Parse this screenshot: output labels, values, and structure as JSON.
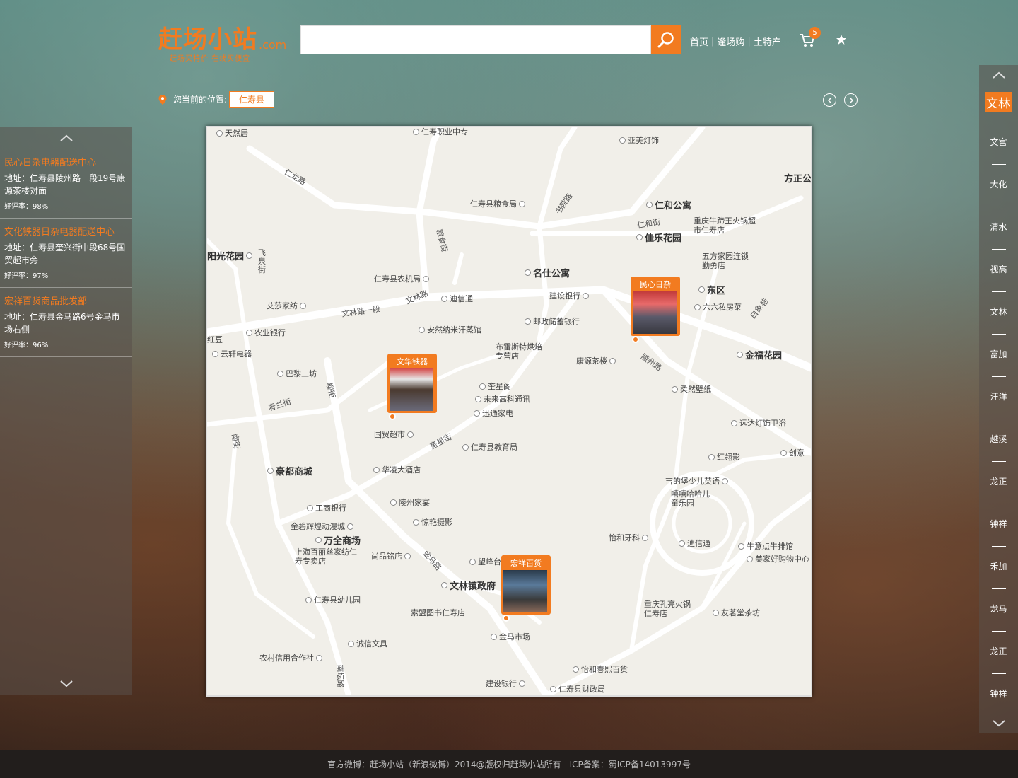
{
  "brand": {
    "logo_text": "赶场小站",
    "logo_domain": ".com",
    "slogan": "赶场买特价  在线买便宜"
  },
  "search": {
    "value": "",
    "placeholder": ""
  },
  "topnav": {
    "items": [
      "首页",
      "逢场购",
      "土特产"
    ],
    "cart_count": "5"
  },
  "location": {
    "label": "您当前的位置:",
    "current": "仁寿县"
  },
  "left_panel": {
    "shops": [
      {
        "name": "民心日杂电器配送中心",
        "address": "地址：仁寿县陵州路一段19号康源茶楼对面",
        "rating": "好评率：98%"
      },
      {
        "name": "文化铁器日杂电器配送中心",
        "address": "地址：仁寿县奎兴街中段68号国贸超市旁",
        "rating": "好评率：97%"
      },
      {
        "name": "宏祥百货商品批发部",
        "address": "地址：仁寿县金马路6号金马市场右侧",
        "rating": "好评率：96%"
      }
    ]
  },
  "map": {
    "markers": [
      {
        "title": "民心日杂"
      },
      {
        "title": "文华铁器"
      },
      {
        "title": "宏祥百货"
      }
    ],
    "roads": [
      "仁龙路",
      "书院路",
      "仁和街",
      "粮食街",
      "文林路一段",
      "文林路",
      "陵州路",
      "白象巷",
      "柳街",
      "春兰街",
      "奎星街",
      "南街",
      "金马路",
      "南坛路"
    ],
    "pois": [
      "天然居",
      "仁寿职业中专",
      "亚美灯饰",
      "方正公",
      "仁寿县粮食局",
      "仁和公寓",
      "重庆牛蹄王火锅超市仁寿店",
      "佳乐花园",
      "阳光花园",
      "飞泉街",
      "五方家园连锁勤勇店",
      "名仕公寓",
      "仁寿县农机局",
      "东区",
      "建设银行",
      "艾莎家纺",
      "迪信通",
      "六六私房菜",
      "邮政储蓄银行",
      "农业银行",
      "安然纳米汗蒸馆",
      "金福花园",
      "红豆",
      "云轩电器",
      "布雷斯特烘焙专营店",
      "康源茶楼",
      "巴黎工坊",
      "柔然壁纸",
      "奎星阁",
      "未来高科通讯",
      "远达灯饰卫浴",
      "迅通家电",
      "国贸超市",
      "仁寿县教育局",
      "红翎影",
      "创意",
      "豪都商城",
      "华凌大酒店",
      "吉的堡少儿英语",
      "嘻嘻哈哈儿童乐园",
      "工商银行",
      "陵州家宴",
      "怡和牙科",
      "金碧辉煌动漫城",
      "惊艳摄影",
      "万全商场",
      "迪信通",
      "牛意点牛排馆",
      "上海百丽丝家纺仁寿专卖店",
      "尚品铭店",
      "望峰台",
      "美家好购物中心",
      "文林镇政府",
      "仁寿县幼儿园",
      "索盟图书仁寿店",
      "重庆孔亮火锅仁寿店",
      "友茗堂茶坊",
      "金马市场",
      "诚信文具",
      "农村信用合作社",
      "怡和春熙百货",
      "建设银行",
      "仁寿县财政局"
    ]
  },
  "right_panel": {
    "towns": [
      "文林",
      "文宫",
      "大化",
      "清水",
      "视高",
      "文林",
      "富加",
      "汪洋",
      "越溪",
      "龙正",
      "钟祥",
      "禾加",
      "龙马",
      "龙正",
      "钟祥"
    ]
  },
  "footer": {
    "text": "官方微博：赶场小站（新浪微博）2014@版权归赶场小站所有　ICP备案：蜀ICP备14013997号"
  },
  "colors": {
    "accent": "#f27b20",
    "panel": "rgba(90,80,75,0.55)",
    "footer_bg": "#221e1c"
  },
  "icons": [
    "search-icon",
    "cart-icon",
    "star-icon",
    "location-pin-icon",
    "chevron-up-icon",
    "chevron-down-icon",
    "chevron-left-icon",
    "chevron-right-icon"
  ]
}
